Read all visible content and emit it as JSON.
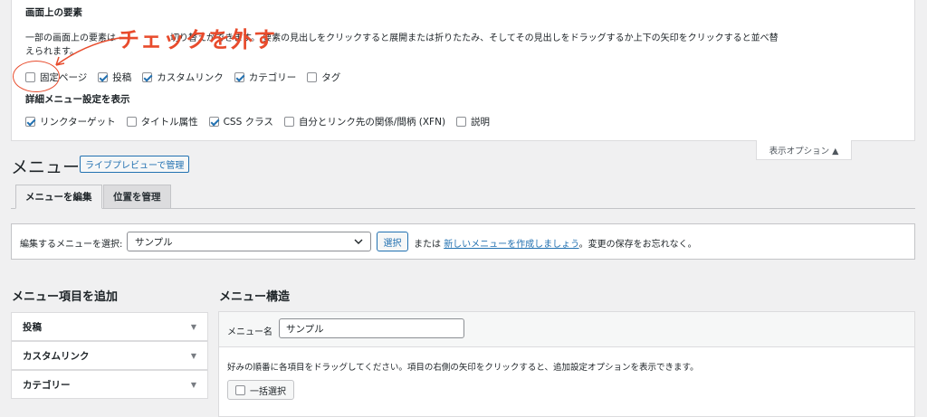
{
  "screen_options": {
    "elements_title": "画面上の要素",
    "description_start": "一部の画面上の要素は",
    "description_rest": "切り替えができます。 要素の見出しをクリックすると展開または折りたたみ、そしてその見出しをドラッグするか上下の矢印をクリックすると並べ替",
    "description_line2": "えられます。",
    "elements": [
      {
        "label": "固定ページ",
        "checked": false
      },
      {
        "label": "投稿",
        "checked": true
      },
      {
        "label": "カスタムリンク",
        "checked": true
      },
      {
        "label": "カテゴリー",
        "checked": true
      },
      {
        "label": "タグ",
        "checked": false
      }
    ],
    "advanced_title": "詳細メニュー設定を表示",
    "advanced": [
      {
        "label": "リンクターゲット",
        "checked": true
      },
      {
        "label": "タイトル属性",
        "checked": false
      },
      {
        "label": "CSS クラス",
        "checked": true
      },
      {
        "label": "自分とリンク先の関係/間柄 (XFN)",
        "checked": false
      },
      {
        "label": "説明",
        "checked": false
      }
    ],
    "toggle_label": "表示オプション ▲"
  },
  "annotation": {
    "text": "チェックを外す",
    "color": "#e84b2c"
  },
  "page": {
    "title": "メニュー",
    "live_preview_button": "ライブプレビューで管理",
    "tabs": [
      {
        "label": "メニューを編集",
        "active": true
      },
      {
        "label": "位置を管理",
        "active": false
      }
    ]
  },
  "select_menu": {
    "label": "編集するメニューを選択:",
    "selected": "サンプル",
    "select_button": "選択",
    "or_text": "または",
    "create_link": "新しいメニューを作成しましょう",
    "save_reminder": "。変更の保存をお忘れなく。"
  },
  "add_items": {
    "title": "メニュー項目を追加",
    "panels": [
      "投稿",
      "カスタムリンク",
      "カテゴリー"
    ]
  },
  "structure": {
    "title": "メニュー構造",
    "menu_name_label": "メニュー名",
    "menu_name_value": "サンプル",
    "instructions": "好みの順番に各項目をドラッグしてください。項目の右側の矢印をクリックすると、追加設定オプションを表示できます。",
    "bulk_select_label": "一括選択"
  },
  "colors": {
    "accent": "#2271b1",
    "annotation": "#e84b2c"
  }
}
